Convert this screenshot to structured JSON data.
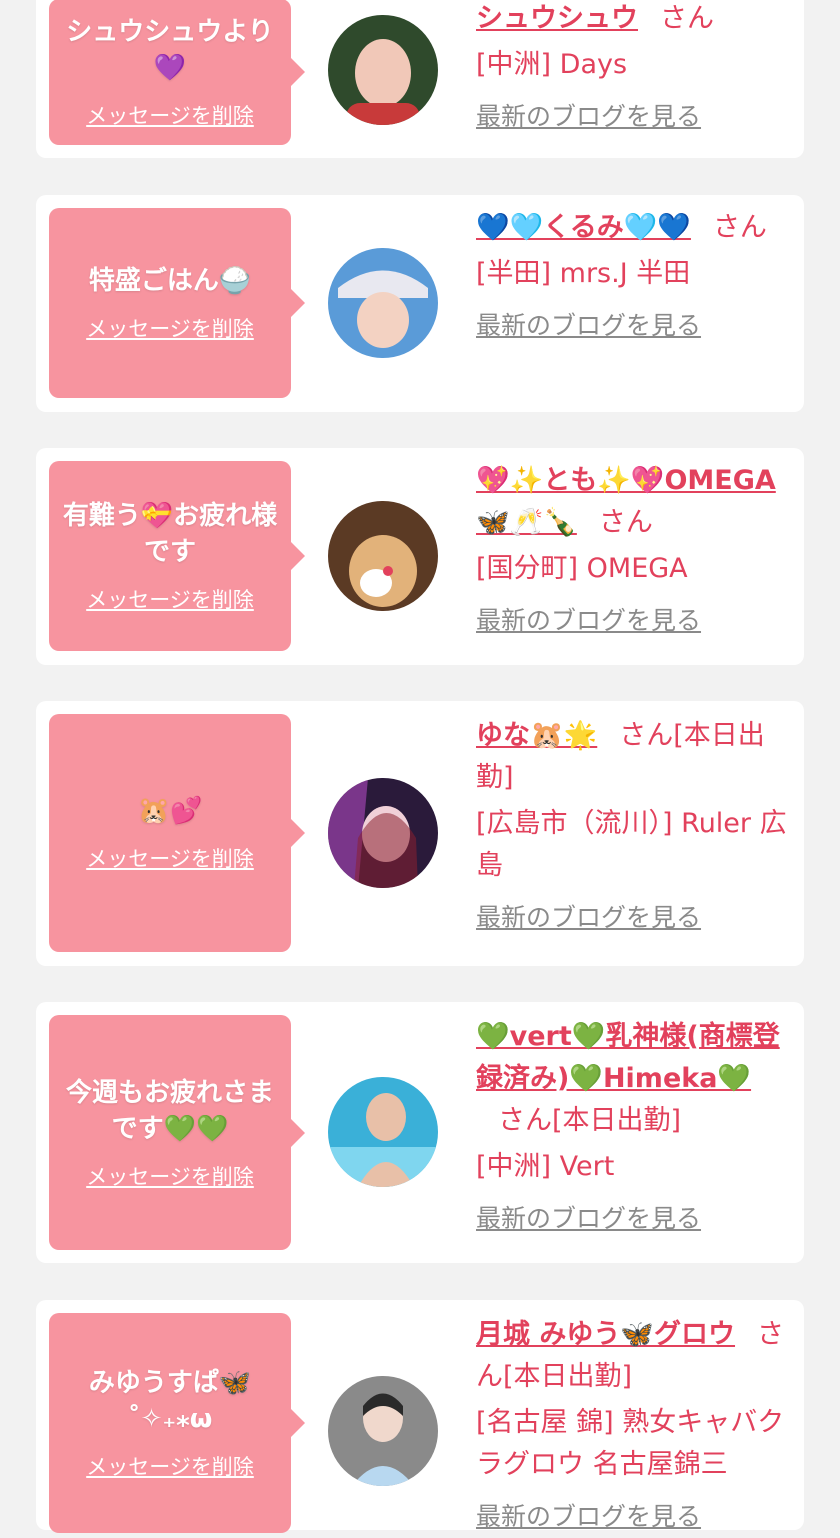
{
  "messages": [
    {
      "bubble_text": "シュウシュウより💜",
      "delete_label": "メッセージを削除",
      "name": "シュウシュウ",
      "suffix": "さん",
      "shop": "[中洲] Days",
      "blog_label": "最新のブログを見る",
      "avatar_colors": [
        "#2f4a2c",
        "#f1c8b8",
        "#c83a3a"
      ]
    },
    {
      "bubble_text": "特盛ごはん🍚",
      "delete_label": "メッセージを削除",
      "name": "💙🩵くるみ🩵💙",
      "suffix": "さん",
      "shop": "[半田] mrs.J 半田",
      "blog_label": "最新のブログを見る",
      "avatar_colors": [
        "#5a9bd8",
        "#f3d2c2",
        "#e8e8f0"
      ]
    },
    {
      "bubble_text": "有難う💝お疲れ様です",
      "delete_label": "メッセージを削除",
      "name": "💖✨とも✨💖OMEGA🦋🥂🍾",
      "suffix": "さん",
      "shop": "[国分町] OMEGA",
      "blog_label": "最新のブログを見る",
      "avatar_colors": [
        "#5b3a24",
        "#e2b27a",
        "#ffffff"
      ]
    },
    {
      "bubble_text": "🐹💕",
      "delete_label": "メッセージを削除",
      "name": "ゆな🐹🌟",
      "suffix": "さん[本日出勤]",
      "shop": "[広島市（流川）] Ruler 広島",
      "blog_label": "最新のブログを見る",
      "avatar_colors": [
        "#2a1a3a",
        "#b04ac0",
        "#f0d0d8"
      ]
    },
    {
      "bubble_text": "今週もお疲れさまです💚💚",
      "delete_label": "メッセージを削除",
      "name": "💚vert💚乳神様(商標登録済み)💚Himeka💚",
      "suffix": "さん[本日出勤]",
      "shop": "[中洲] Vert",
      "blog_label": "最新のブログを見る",
      "avatar_colors": [
        "#3ab0d8",
        "#e8c0a8",
        "#7fd6ef"
      ]
    },
    {
      "bubble_text": "みゆうすぱ🦋 ˚✧₊⁎ω",
      "delete_label": "メッセージを削除",
      "name": "月城 みゆう🦋グロウ",
      "suffix": "さん[本日出勤]",
      "shop": "[名古屋 錦] 熟女キャバクラグロウ 名古屋錦三",
      "blog_label": "最新のブログを見る",
      "avatar_colors": [
        "#8a8a8a",
        "#f0d8cc",
        "#b8d8f0"
      ]
    }
  ]
}
